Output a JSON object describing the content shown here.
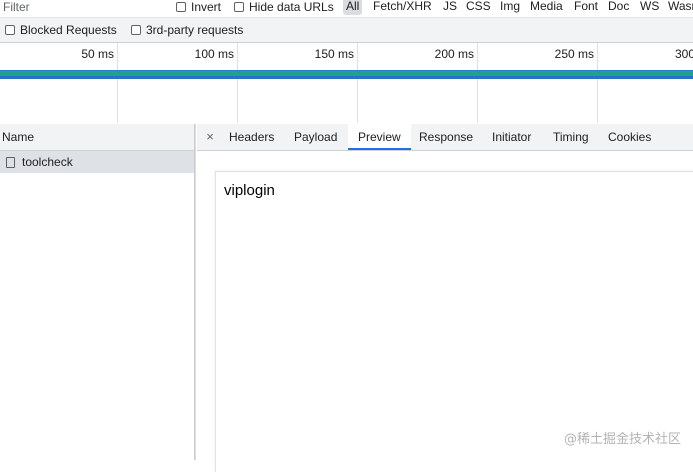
{
  "filter": {
    "placeholder": "Filter",
    "invert_label": "Invert",
    "hide_data_urls_label": "Hide data URLs",
    "types": [
      "All",
      "Fetch/XHR",
      "JS",
      "CSS",
      "Img",
      "Media",
      "Font",
      "Doc",
      "WS",
      "Wasm"
    ],
    "active_type": "All"
  },
  "options": {
    "blocked_requests_label": "Blocked Requests",
    "third_party_label": "3rd-party requests"
  },
  "timeline": {
    "ticks": [
      "50 ms",
      "100 ms",
      "150 ms",
      "200 ms",
      "250 ms",
      "300"
    ],
    "bar_color": "#1ea38a",
    "bar_edge_color": "#2d6fcb"
  },
  "request_list": {
    "column_name": "Name",
    "rows": [
      {
        "name": "toolcheck",
        "selected": true
      }
    ]
  },
  "detail": {
    "close_icon": "×",
    "tabs": [
      "Headers",
      "Payload",
      "Preview",
      "Response",
      "Initiator",
      "Timing",
      "Cookies"
    ],
    "selected_tab": "Preview",
    "preview_content": "viplogin"
  },
  "watermark": "@稀土掘金技术社区",
  "colors": {
    "accent": "#1a73e8",
    "selected_row": "#dee1e6",
    "toolbar_bg": "#f1f3f4"
  }
}
